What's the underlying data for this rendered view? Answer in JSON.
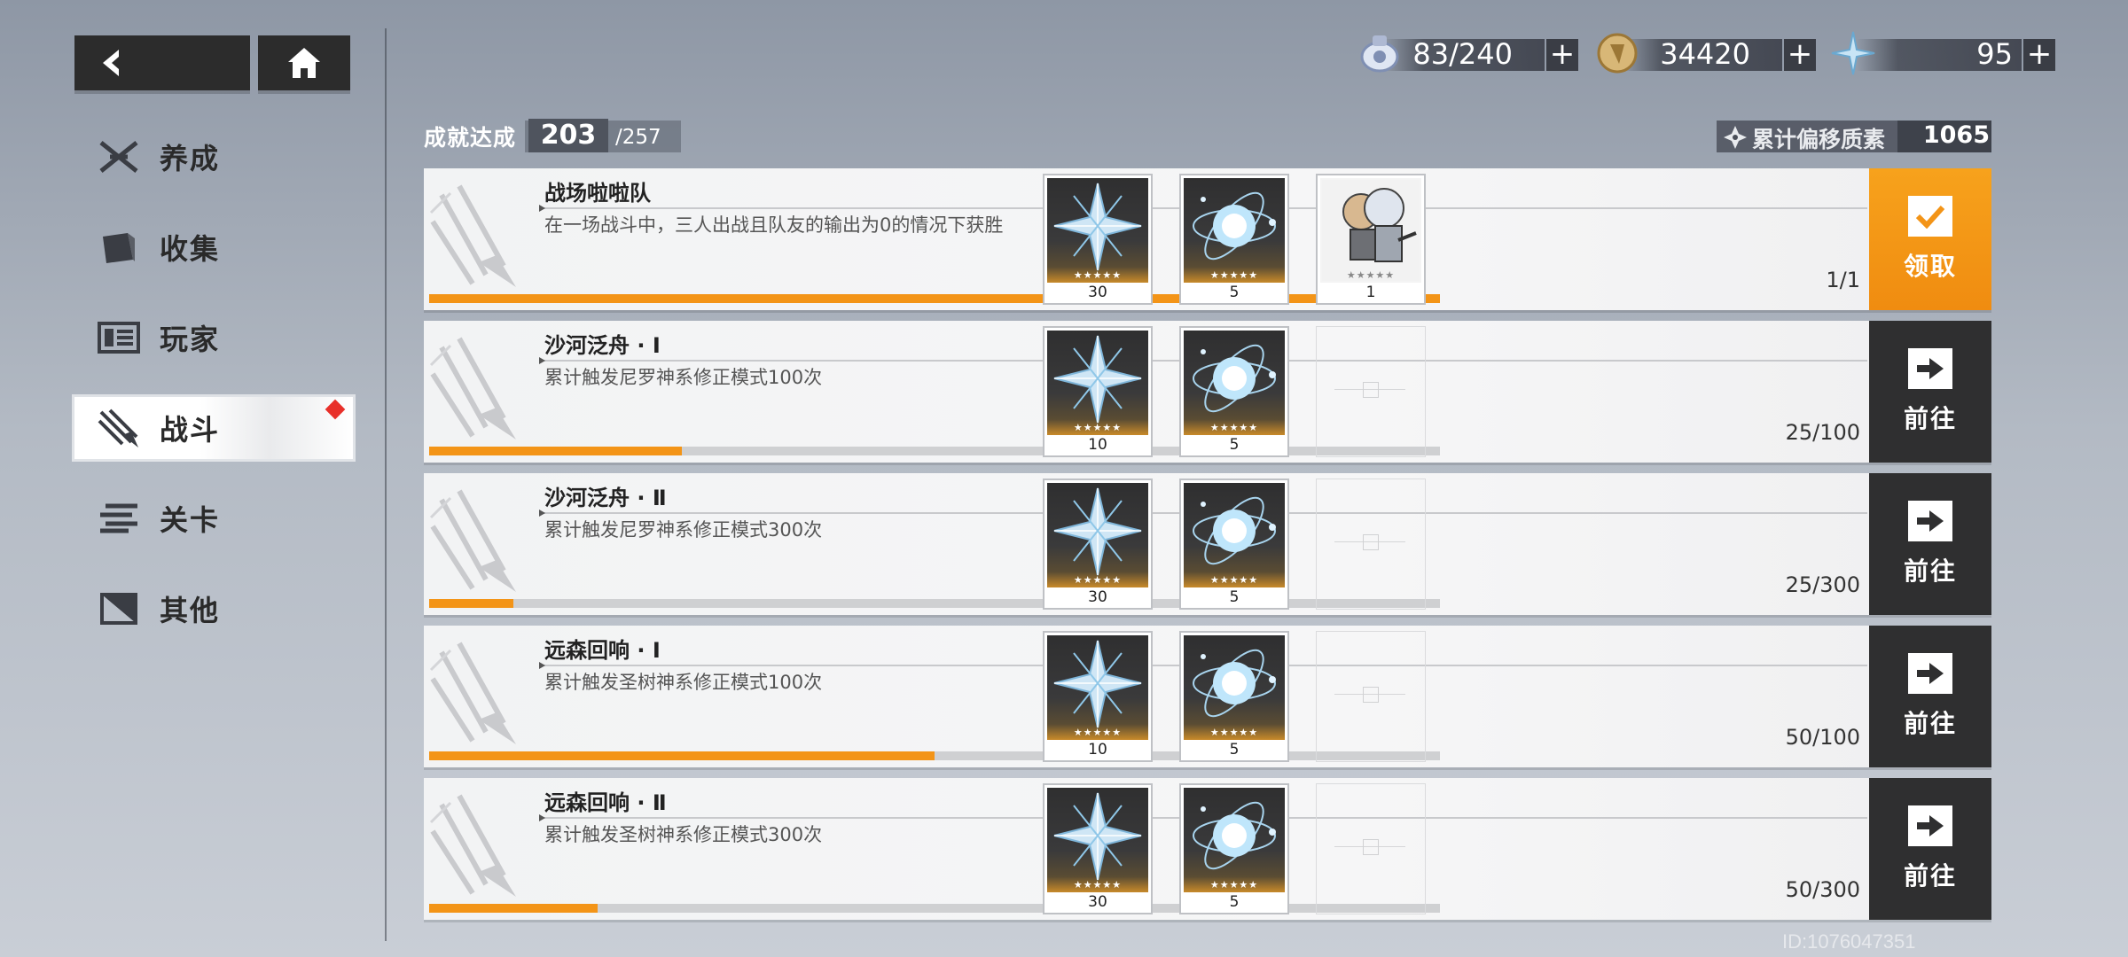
{
  "nav": {
    "back_icon": "back-arrow-icon",
    "home_icon": "home-icon"
  },
  "currencies": [
    {
      "icon": "stamina-icon",
      "value": "83/240",
      "plus": "+"
    },
    {
      "icon": "coin-icon",
      "value": "34420",
      "plus": "+"
    },
    {
      "icon": "crystal-icon",
      "value": "95",
      "plus": "+"
    }
  ],
  "sidebar": {
    "items": [
      {
        "label": "养成",
        "icon": "cultivate-icon"
      },
      {
        "label": "收集",
        "icon": "collection-icon"
      },
      {
        "label": "玩家",
        "icon": "player-icon"
      },
      {
        "label": "战斗",
        "icon": "battle-icon",
        "active": true,
        "badge": true
      },
      {
        "label": "关卡",
        "icon": "stage-icon"
      },
      {
        "label": "其他",
        "icon": "other-icon"
      }
    ]
  },
  "header": {
    "achievement_label": "成就达成",
    "achievement_count": "203",
    "achievement_total": "/257",
    "drift_label": "累计偏移质素",
    "drift_value": "1065"
  },
  "achievements": [
    {
      "title": "战场啦啦队",
      "desc": "在一场战斗中，三人出战且队友的输出为0的情况下获胜",
      "progress_text": "1/1",
      "progress": 1.0,
      "rewards": [
        {
          "type": "crystal",
          "stars": "★★★★★",
          "count": "30"
        },
        {
          "type": "orb",
          "stars": "★★★★★",
          "count": "5"
        },
        {
          "type": "character",
          "stars": "★★★★★",
          "count": "1"
        }
      ],
      "action": {
        "kind": "claim",
        "label": "领取",
        "icon": "check-icon"
      }
    },
    {
      "title": "沙河泛舟 · Ⅰ",
      "desc": "累计触发尼罗神系修正模式100次",
      "progress_text": "25/100",
      "progress": 0.25,
      "rewards": [
        {
          "type": "crystal",
          "stars": "★★★★★",
          "count": "10"
        },
        {
          "type": "orb",
          "stars": "★★★★★",
          "count": "5"
        }
      ],
      "action": {
        "kind": "goto",
        "label": "前往",
        "icon": "goto-arrow-icon"
      }
    },
    {
      "title": "沙河泛舟 · Ⅱ",
      "desc": "累计触发尼罗神系修正模式300次",
      "progress_text": "25/300",
      "progress": 0.0833,
      "rewards": [
        {
          "type": "crystal",
          "stars": "★★★★★",
          "count": "30"
        },
        {
          "type": "orb",
          "stars": "★★★★★",
          "count": "5"
        }
      ],
      "action": {
        "kind": "goto",
        "label": "前往",
        "icon": "goto-arrow-icon"
      }
    },
    {
      "title": "远森回响 · Ⅰ",
      "desc": "累计触发圣树神系修正模式100次",
      "progress_text": "50/100",
      "progress": 0.5,
      "rewards": [
        {
          "type": "crystal",
          "stars": "★★★★★",
          "count": "10"
        },
        {
          "type": "orb",
          "stars": "★★★★★",
          "count": "5"
        }
      ],
      "action": {
        "kind": "goto",
        "label": "前往",
        "icon": "goto-arrow-icon"
      }
    },
    {
      "title": "远森回响 · Ⅱ",
      "desc": "累计触发圣树神系修正模式300次",
      "progress_text": "50/300",
      "progress": 0.1667,
      "rewards": [
        {
          "type": "crystal",
          "stars": "★★★★★",
          "count": "30"
        },
        {
          "type": "orb",
          "stars": "★★★★★",
          "count": "5"
        }
      ],
      "action": {
        "kind": "goto",
        "label": "前往",
        "icon": "goto-arrow-icon"
      }
    }
  ],
  "footer": {
    "uid": "ID:1076047351"
  },
  "colors": {
    "accent": "#f39417",
    "dark": "#2f2f30",
    "badge": "#e8302a"
  }
}
